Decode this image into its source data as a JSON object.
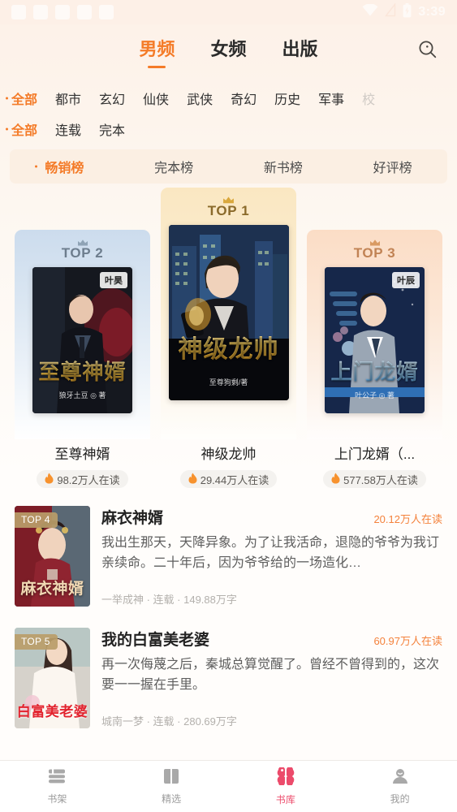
{
  "status_bar": {
    "time": "3:39",
    "icons": [
      "wifi-icon",
      "signal-off-icon",
      "battery-charging-icon"
    ],
    "placeholder_blocks": 5
  },
  "header": {
    "tabs": [
      {
        "label": "男频",
        "active": true
      },
      {
        "label": "女频",
        "active": false
      },
      {
        "label": "出版",
        "active": false
      }
    ],
    "search_icon": "search-icon"
  },
  "filters": {
    "category_row": [
      {
        "label": "全部",
        "active": true,
        "faded": false
      },
      {
        "label": "都市",
        "active": false,
        "faded": false
      },
      {
        "label": "玄幻",
        "active": false,
        "faded": false
      },
      {
        "label": "仙侠",
        "active": false,
        "faded": false
      },
      {
        "label": "武侠",
        "active": false,
        "faded": false
      },
      {
        "label": "奇幻",
        "active": false,
        "faded": false
      },
      {
        "label": "历史",
        "active": false,
        "faded": false
      },
      {
        "label": "军事",
        "active": false,
        "faded": false
      },
      {
        "label": "校",
        "active": false,
        "faded": true
      }
    ],
    "status_row": [
      {
        "label": "全部",
        "active": true,
        "faded": false
      },
      {
        "label": "连载",
        "active": false,
        "faded": false
      },
      {
        "label": "完本",
        "active": false,
        "faded": false
      }
    ]
  },
  "rank_tabs": [
    {
      "label": "畅销榜",
      "active": true
    },
    {
      "label": "完本榜",
      "active": false
    },
    {
      "label": "新书榜",
      "active": false
    },
    {
      "label": "好评榜",
      "active": false
    }
  ],
  "podium": [
    {
      "rank_label": "TOP 2",
      "rank": 2,
      "title": "至尊神婿",
      "cover_title": "至尊神婿",
      "cover_author_badge": "叶昊",
      "cover_sub": "狼牙土豆 ◎ 著",
      "readers": "98.2万人在读",
      "fire_icon": "fire-icon"
    },
    {
      "rank_label": "TOP 1",
      "rank": 1,
      "title": "神级龙帅",
      "cover_title": "神级龙帅",
      "cover_author_badge": "",
      "cover_sub": "至尊狗剩/著",
      "readers": "29.44万人在读",
      "fire_icon": "fire-icon"
    },
    {
      "rank_label": "TOP 3",
      "rank": 3,
      "title": "上门龙婿（...",
      "cover_title": "上门龙婿",
      "cover_author_badge": "叶辰",
      "cover_sub": "叶公子 ◎ 著",
      "readers": "577.58万人在读",
      "fire_icon": "fire-icon"
    }
  ],
  "book_list": [
    {
      "badge": "TOP 4",
      "title": "麻衣神婿",
      "cover_title": "麻衣神婿",
      "readers": "20.12万人在读",
      "description": "我出生那天，天降异象。为了让我活命，退隐的爷爷为我订亲续命。二十年后，因为爷爷给的一场造化…",
      "meta": "一举成神 · 连载 · 149.88万字"
    },
    {
      "badge": "TOP 5",
      "title": "我的白富美老婆",
      "cover_title": "白富美老婆",
      "readers": "60.97万人在读",
      "description": "再一次侮蔑之后，秦城总算觉醒了。曾经不曾得到的，这次要一一握在手里。",
      "meta": "城南一梦 · 连载 · 280.69万字"
    }
  ],
  "bottom_nav": [
    {
      "label": "书架",
      "icon": "bookshelf-icon",
      "active": false
    },
    {
      "label": "精选",
      "icon": "book-open-icon",
      "active": false
    },
    {
      "label": "书库",
      "icon": "library-clover-icon",
      "active": true
    },
    {
      "label": "我的",
      "icon": "user-profile-icon",
      "active": false
    }
  ],
  "colors": {
    "accent_orange": "#f47b28",
    "accent_pink": "#ec4b6b",
    "readers_orange": "#f4823c",
    "header_bg": "#fdf0e7",
    "ranktab_bg": "#fbefe3"
  }
}
